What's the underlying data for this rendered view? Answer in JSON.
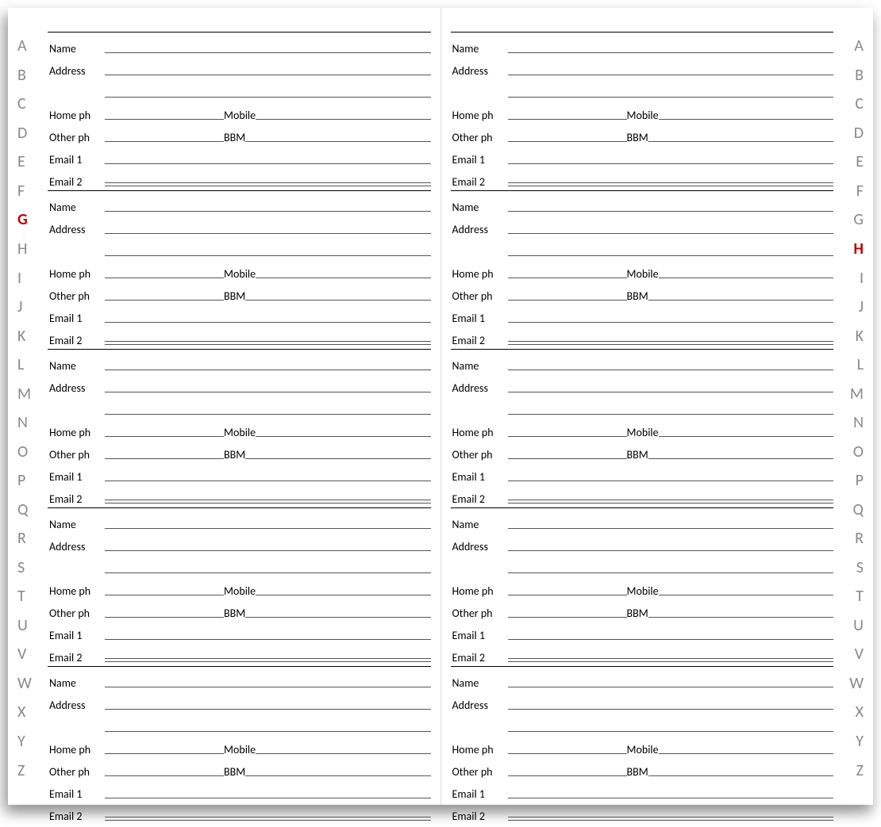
{
  "alphabet": [
    "A",
    "B",
    "C",
    "D",
    "E",
    "F",
    "G",
    "H",
    "I",
    "J",
    "K",
    "L",
    "M",
    "N",
    "O",
    "P",
    "Q",
    "R",
    "S",
    "T",
    "U",
    "V",
    "W",
    "X",
    "Y",
    "Z"
  ],
  "highlight_left": "G",
  "highlight_right": "H",
  "labels": {
    "name": "Name",
    "address": "Address",
    "home_ph": "Home ph",
    "mobile": "Mobile",
    "other_ph": "Other ph",
    "bbm": "BBM",
    "email1": "Email 1",
    "email2": "Email 2"
  },
  "entries_per_page": 5,
  "pages": 2
}
